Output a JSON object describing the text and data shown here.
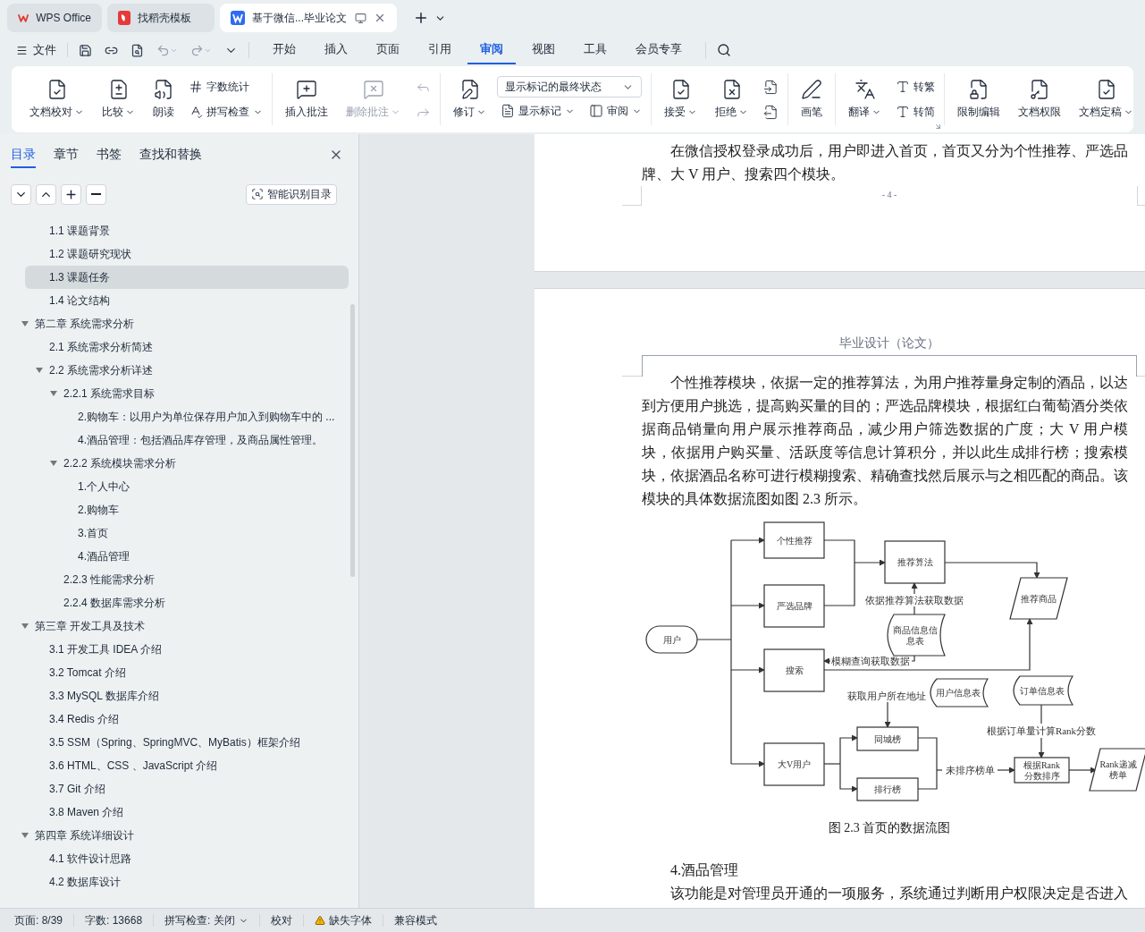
{
  "title_tabs": [
    {
      "label": "WPS Office",
      "selected": false
    },
    {
      "label": "找稻壳模板",
      "selected": false
    },
    {
      "label": "基于微信...毕业论文",
      "selected": true
    }
  ],
  "menu": {
    "file": "文件",
    "tabs": [
      {
        "label": "开始",
        "selected": false
      },
      {
        "label": "插入",
        "selected": false
      },
      {
        "label": "页面",
        "selected": false
      },
      {
        "label": "引用",
        "selected": false
      },
      {
        "label": "审阅",
        "selected": true
      },
      {
        "label": "视图",
        "selected": false
      },
      {
        "label": "工具",
        "selected": false
      },
      {
        "label": "会员专享",
        "selected": false
      }
    ]
  },
  "ribbon": [
    [
      [
        {
          "kind": "big",
          "label": "文档校对",
          "dropdown": true,
          "disabled": false
        }
      ],
      [
        {
          "kind": "big",
          "label": "比较",
          "dropdown": true,
          "disabled": false
        }
      ],
      [
        {
          "kind": "big",
          "label": "朗读",
          "dropdown": false,
          "disabled": false
        }
      ],
      [
        {
          "kind": "small",
          "label": "字数统计",
          "dropdown": false,
          "disabled": false
        },
        {
          "kind": "small",
          "label": "拼写检查",
          "dropdown": true,
          "disabled": false
        }
      ]
    ],
    [
      [
        {
          "kind": "big",
          "label": "插入批注",
          "dropdown": false,
          "disabled": false
        }
      ],
      [
        {
          "kind": "big",
          "label": "删除批注",
          "dropdown": true,
          "disabled": true
        }
      ],
      [
        {
          "kind": "icon",
          "disabled": true
        },
        {
          "kind": "icon",
          "disabled": true
        }
      ]
    ],
    [
      [
        {
          "kind": "big",
          "label": "修订",
          "dropdown": true,
          "disabled": false
        }
      ],
      [
        {
          "kind": "select",
          "value": "显示标记的最终状态"
        },
        {
          "kind": "row",
          "items": [
            {
              "kind": "small",
              "label": "显示标记",
              "dropdown": true,
              "disabled": false
            },
            {
              "kind": "small",
              "label": "审阅",
              "dropdown": true,
              "disabled": false
            }
          ]
        }
      ]
    ],
    [
      [
        {
          "kind": "big",
          "label": "接受",
          "dropdown": true,
          "disabled": false
        }
      ],
      [
        {
          "kind": "big",
          "label": "拒绝",
          "dropdown": true,
          "disabled": false
        }
      ],
      [
        {
          "kind": "icon",
          "disabled": false
        },
        {
          "kind": "icon",
          "disabled": false
        }
      ]
    ],
    [
      [
        {
          "kind": "big",
          "label": "画笔",
          "dropdown": false,
          "disabled": false
        }
      ]
    ],
    [
      [
        {
          "kind": "big",
          "label": "翻译",
          "dropdown": true,
          "disabled": false
        }
      ],
      [
        {
          "kind": "small",
          "label": "转繁",
          "dropdown": false,
          "disabled": false
        },
        {
          "kind": "small",
          "label": "转简",
          "dropdown": false,
          "disabled": false
        }
      ]
    ],
    [
      [
        {
          "kind": "big",
          "label": "限制编辑",
          "dropdown": false,
          "disabled": false
        }
      ],
      [
        {
          "kind": "big",
          "label": "文档权限",
          "dropdown": false,
          "disabled": false
        }
      ],
      [
        {
          "kind": "big",
          "label": "文档定稿",
          "dropdown": true,
          "disabled": false
        }
      ]
    ]
  ],
  "sidebar": {
    "tabs": [
      {
        "label": "目录",
        "selected": true
      },
      {
        "label": "章节",
        "selected": false
      },
      {
        "label": "书签",
        "selected": false
      },
      {
        "label": "查找和替换",
        "selected": false
      }
    ],
    "smart_button": "智能识别目录",
    "toc": [
      {
        "children": [
          {
            "label": "1.1 课题背景",
            "selected": false
          },
          {
            "label": "1.2 课题研究现状",
            "selected": false
          },
          {
            "label": "1.3 课题任务",
            "selected": true
          },
          {
            "label": "1.4 论文结构",
            "selected": false
          }
        ]
      },
      {
        "label": "第二章  系统需求分析",
        "selected": false,
        "expanded": true,
        "children": [
          {
            "label": "2.1 系统需求分析简述",
            "selected": false
          },
          {
            "label": "2.2 系统需求分析详述",
            "selected": false,
            "expanded": true,
            "children": [
              {
                "label": "2.2.1 系统需求目标",
                "selected": false,
                "expanded": true,
                "children": [
                  {
                    "label": "2.购物车：以用户为单位保存用户加入到购物车中的 ...",
                    "selected": false
                  },
                  {
                    "label": "4.酒品管理：包括酒品库存管理，及商品属性管理。",
                    "selected": false
                  }
                ]
              },
              {
                "label": "2.2.2 系统模块需求分析",
                "selected": false,
                "expanded": true,
                "children": [
                  {
                    "label": "1.个人中心",
                    "selected": false
                  },
                  {
                    "label": "2.购物车",
                    "selected": false
                  },
                  {
                    "label": "3.首页",
                    "selected": false
                  },
                  {
                    "label": "4.酒品管理",
                    "selected": false
                  }
                ]
              },
              {
                "label": "2.2.3 性能需求分析",
                "selected": false
              },
              {
                "label": "2.2.4 数据库需求分析",
                "selected": false
              }
            ]
          }
        ]
      },
      {
        "label": "第三章    开发工具及技术",
        "selected": false,
        "expanded": true,
        "children": [
          {
            "label": "3.1 开发工具 IDEA 介绍",
            "selected": false
          },
          {
            "label": "3.2 Tomcat 介绍",
            "selected": false
          },
          {
            "label": "3.3 MySQL 数据库介绍",
            "selected": false
          },
          {
            "label": "3.4 Redis 介绍",
            "selected": false
          },
          {
            "label": "3.5 SSM（Spring、SpringMVC、MyBatis）框架介绍",
            "selected": false
          },
          {
            "label": "3.6 HTML、CSS 、JavaScript 介绍",
            "selected": false
          },
          {
            "label": "3.7 Git 介绍",
            "selected": false
          },
          {
            "label": "3.8 Maven 介绍",
            "selected": false
          }
        ]
      },
      {
        "label": "第四章  系统详细设计",
        "selected": false,
        "expanded": true,
        "children": [
          {
            "label": "4.1 软件设计思路",
            "selected": false
          },
          {
            "label": "4.2 数据库设计",
            "selected": false
          }
        ]
      }
    ]
  },
  "document": {
    "page1": {
      "paragraph": "在微信授权登录成功后，用户即进入首页，首页又分为个性推荐、严选品牌、大 V 用户、搜索四个模块。",
      "page_number": "- 4 -"
    },
    "page2": {
      "header": "毕业设计（论文）",
      "paragraph": "个性推荐模块，依据一定的推荐算法，为用户推荐量身定制的酒品，以达到方便用户挑选，提高购买量的目的；严选品牌模块，根据红白葡萄酒分类依据商品销量向用户展示推荐商品，减少用户筛选数据的广度；大 V 用户模块，依据用户购买量、活跃度等信息计算积分，并以此生成排行榜；搜索模块，依据酒品名称可进行模糊搜索、精确查找然后展示与之相匹配的商品。该模块的具体数据流图如图 2.3 所示。",
      "diagram": {
        "nodes": [
          {
            "kind": "terminal",
            "lines": [
              "用户"
            ]
          },
          {
            "kind": "process",
            "lines": [
              "个性推荐"
            ]
          },
          {
            "kind": "process",
            "lines": [
              "严选品牌"
            ]
          },
          {
            "kind": "process",
            "lines": [
              "搜索"
            ]
          },
          {
            "kind": "process",
            "lines": [
              "大V用户"
            ]
          },
          {
            "kind": "process",
            "lines": [
              "推荐算法"
            ]
          },
          {
            "kind": "data",
            "lines": [
              "推荐商品"
            ]
          },
          {
            "kind": "store",
            "lines": [
              "商品信息信",
              "息表"
            ]
          },
          {
            "kind": "store",
            "lines": [
              "用户信息表"
            ]
          },
          {
            "kind": "store",
            "lines": [
              "订单信息表"
            ]
          },
          {
            "kind": "process",
            "lines": [
              "同城榜"
            ]
          },
          {
            "kind": "process",
            "lines": [
              "排行榜"
            ]
          },
          {
            "kind": "process",
            "lines": [
              "根据Rank",
              "分数排序"
            ]
          },
          {
            "kind": "data",
            "lines": [
              "Rank递减",
              "榜单"
            ]
          }
        ],
        "edge_labels": [
          "依据推荐算法获取数据",
          "模糊查询获取数据",
          "获取用户所在地址",
          "根据订单量计算Rank分数",
          "未排序榜单"
        ]
      },
      "caption": "图 2.3  首页的数据流图",
      "heading": "4.酒品管理",
      "last_line": "该功能是对管理员开通的一项服务，系统通过判断用户权限决定是否进入"
    }
  },
  "status_bar": {
    "page": "页面: 8/39",
    "words": "字数: 13668",
    "spell": "拼写检查: 关闭",
    "proof": "校对",
    "fonts": "缺失字体",
    "mode": "兼容模式"
  }
}
